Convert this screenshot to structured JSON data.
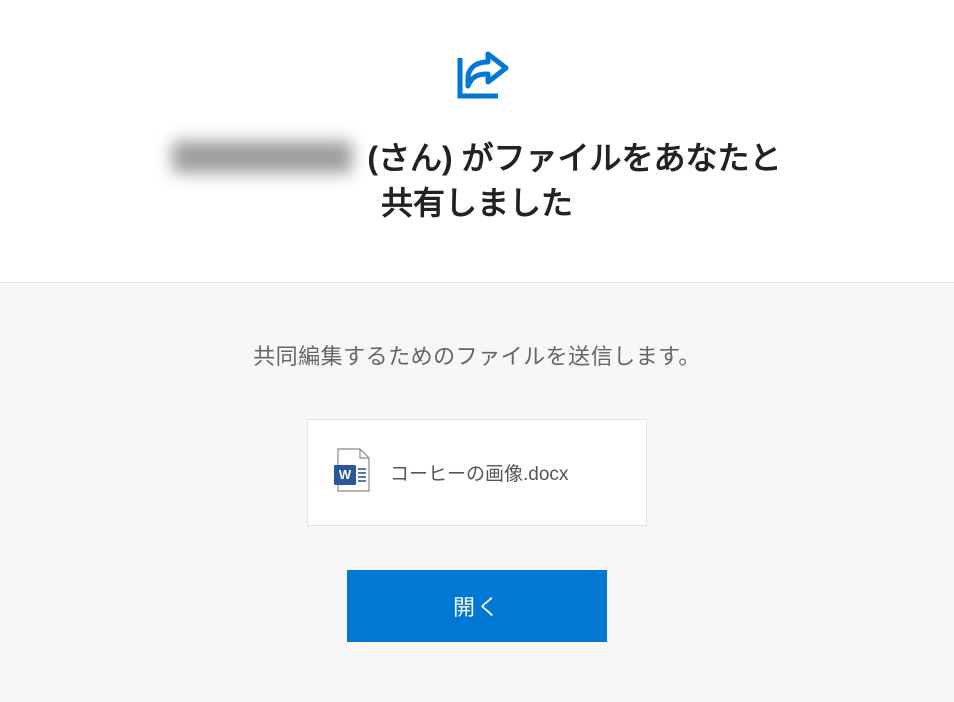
{
  "header": {
    "title_suffix": " (さん) がファイルをあなたと共有しました"
  },
  "body": {
    "description": "共同編集するためのファイルを送信します。",
    "file": {
      "name": "コーヒーの画像.docx",
      "icon": "word-document"
    },
    "open_button_label": "開く"
  },
  "icons": {
    "share": "share-arrow-icon",
    "word": "word-file-icon"
  },
  "colors": {
    "accent": "#0078d4",
    "text_primary": "#222222",
    "text_secondary": "#666666",
    "body_bg": "#f7f7f7"
  }
}
